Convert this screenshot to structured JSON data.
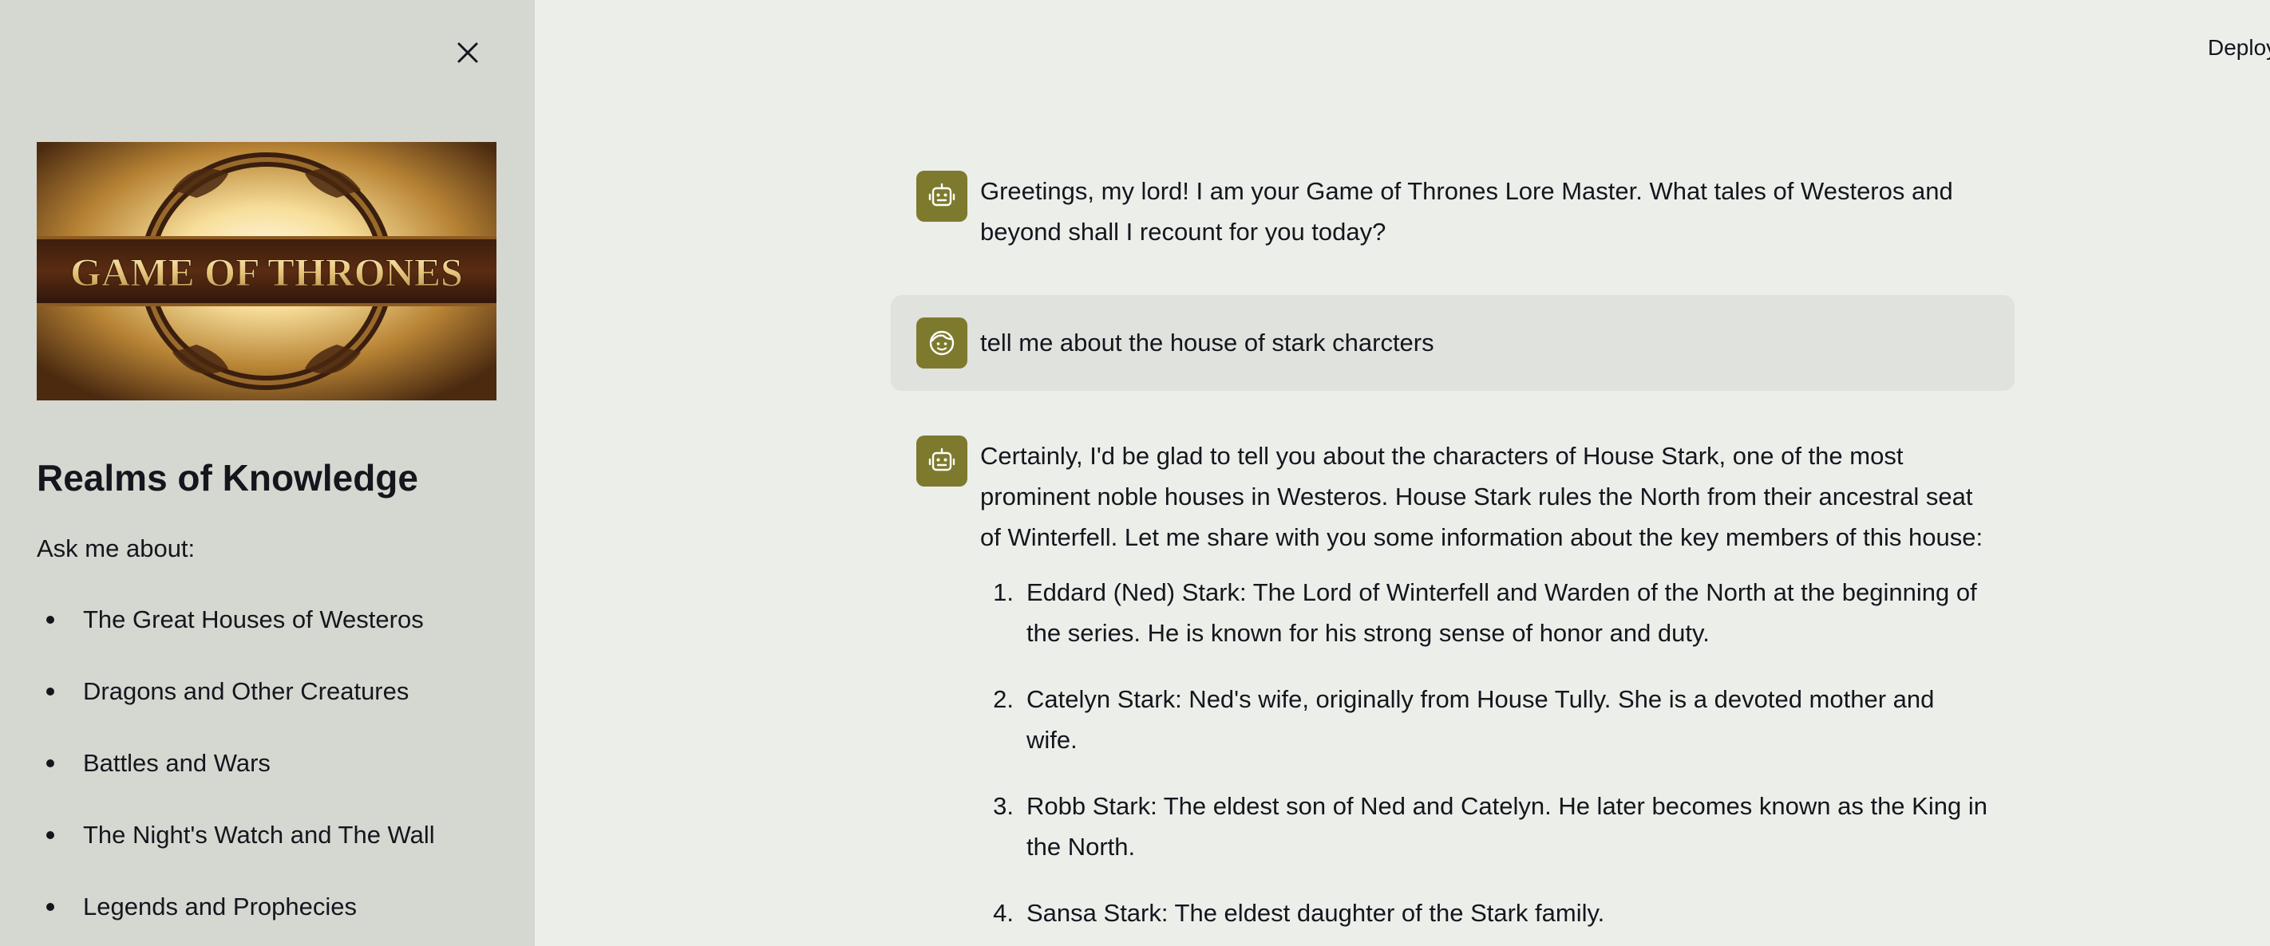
{
  "sidebar": {
    "close_icon": "close-icon",
    "image_logo_text": "GAME OF THRONES",
    "title": "Realms of Knowledge",
    "subtitle": "Ask me about:",
    "topics": [
      "The Great Houses of Westeros",
      "Dragons and Other Creatures",
      "Battles and Wars",
      "The Night's Watch and The Wall",
      "Legends and Prophecies"
    ]
  },
  "header": {
    "deploy_label": "Deploy"
  },
  "chat": {
    "messages": [
      {
        "role": "assistant",
        "text": "Greetings, my lord! I am your Game of Thrones Lore Master. What tales of Westeros and beyond shall I recount for you today?"
      },
      {
        "role": "user",
        "text": "tell me about the house of stark charcters"
      },
      {
        "role": "assistant",
        "text": "Certainly, I'd be glad to tell you about the characters of House Stark, one of the most prominent noble houses in Westeros. House Stark rules the North from their ancestral seat of Winterfell. Let me share with you some information about the key members of this house:",
        "list": [
          {
            "num": "1.",
            "text": "Eddard (Ned) Stark: The Lord of Winterfell and Warden of the North at the beginning of the series. He is known for his strong sense of honor and duty."
          },
          {
            "num": "2.",
            "text": "Catelyn Stark: Ned's wife, originally from House Tully. She is a devoted mother and wife."
          },
          {
            "num": "3.",
            "text": "Robb Stark: The eldest son of Ned and Catelyn. He later becomes known as the King in the North."
          },
          {
            "num": "4.",
            "text": "Sansa Stark: The eldest daughter of the Stark family."
          }
        ]
      }
    ]
  },
  "colors": {
    "sidebar_bg": "#d5d8d1",
    "main_bg": "#eceeea",
    "avatar_bg": "#7d7a2d",
    "user_msg_bg": "#e0e2de"
  }
}
